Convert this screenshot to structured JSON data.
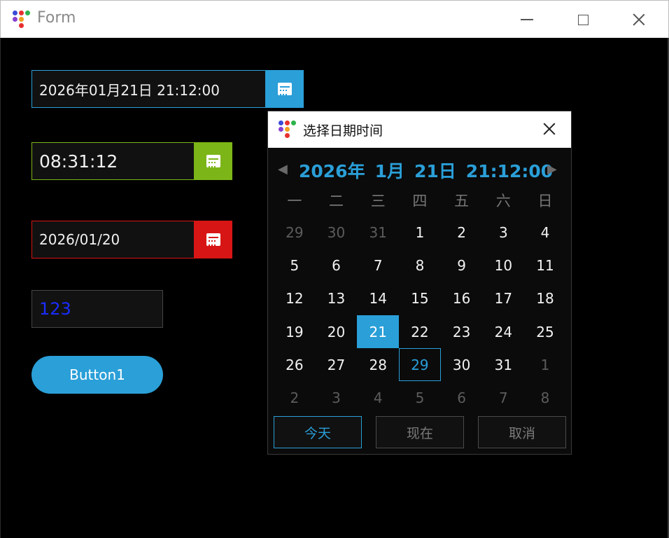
{
  "window": {
    "title": "Form",
    "icon": "app-dots-icon"
  },
  "inputs": {
    "datetime_value": "2026年01月21日 21:12:00",
    "time_value": "08:31:12",
    "date_value": "2026/01/20",
    "number_value": "123"
  },
  "button1": {
    "label": "Button1"
  },
  "picker": {
    "title": "选择日期时间",
    "year": "2026年",
    "month": "1月",
    "day": "21日",
    "time": "21:12:00",
    "prev_glyph": "◀",
    "next_glyph": "▶",
    "weekdays": [
      "一",
      "二",
      "三",
      "四",
      "五",
      "六",
      "日"
    ],
    "days": [
      {
        "d": "29",
        "other": true
      },
      {
        "d": "30",
        "other": true
      },
      {
        "d": "31",
        "other": true
      },
      {
        "d": "1"
      },
      {
        "d": "2"
      },
      {
        "d": "3"
      },
      {
        "d": "4"
      },
      {
        "d": "5"
      },
      {
        "d": "6"
      },
      {
        "d": "7"
      },
      {
        "d": "8"
      },
      {
        "d": "9"
      },
      {
        "d": "10"
      },
      {
        "d": "11"
      },
      {
        "d": "12"
      },
      {
        "d": "13"
      },
      {
        "d": "14"
      },
      {
        "d": "15"
      },
      {
        "d": "16"
      },
      {
        "d": "17"
      },
      {
        "d": "18"
      },
      {
        "d": "19"
      },
      {
        "d": "20"
      },
      {
        "d": "21",
        "selected": true
      },
      {
        "d": "22"
      },
      {
        "d": "23"
      },
      {
        "d": "24"
      },
      {
        "d": "25"
      },
      {
        "d": "26"
      },
      {
        "d": "27"
      },
      {
        "d": "28"
      },
      {
        "d": "29",
        "today": true
      },
      {
        "d": "30"
      },
      {
        "d": "31"
      },
      {
        "d": "1",
        "other": true
      },
      {
        "d": "2",
        "other": true
      },
      {
        "d": "3",
        "other": true
      },
      {
        "d": "4",
        "other": true
      },
      {
        "d": "5",
        "other": true
      },
      {
        "d": "6",
        "other": true
      },
      {
        "d": "7",
        "other": true
      },
      {
        "d": "8",
        "other": true
      }
    ],
    "today_label": "今天",
    "now_label": "现在",
    "cancel_label": "取消"
  },
  "colors": {
    "accent_blue": "#2a9fd8",
    "accent_green": "#7cb518",
    "accent_red": "#d81515",
    "number_text": "#1a2cff"
  }
}
